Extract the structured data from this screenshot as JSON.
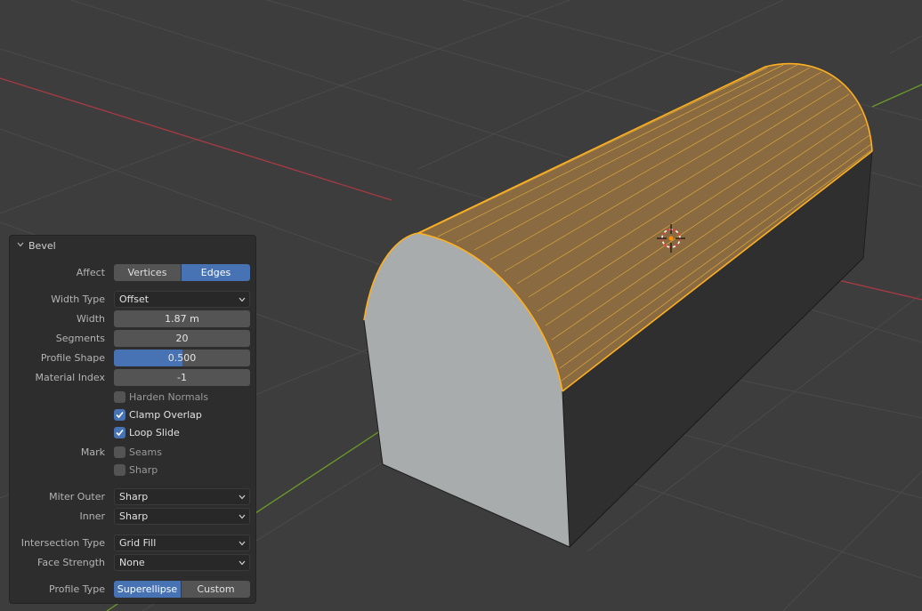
{
  "panel": {
    "title": "Bevel",
    "affect": {
      "label": "Affect",
      "options": [
        "Vertices",
        "Edges"
      ],
      "selected": "Edges"
    },
    "width_type": {
      "label": "Width Type",
      "value": "Offset"
    },
    "width": {
      "label": "Width",
      "value": "1.87 m"
    },
    "segments": {
      "label": "Segments",
      "value": "20"
    },
    "profile_shape": {
      "label": "Profile Shape",
      "value": "0.500",
      "fraction": 0.5
    },
    "material_index": {
      "label": "Material Index",
      "value": "-1"
    },
    "harden_normals": {
      "label": "Harden Normals",
      "checked": false
    },
    "clamp_overlap": {
      "label": "Clamp Overlap",
      "checked": true
    },
    "loop_slide": {
      "label": "Loop Slide",
      "checked": true
    },
    "mark": {
      "label": "Mark",
      "seams": {
        "label": "Seams",
        "checked": false
      },
      "sharp": {
        "label": "Sharp",
        "checked": false
      }
    },
    "miter_outer": {
      "label": "Miter Outer",
      "value": "Sharp"
    },
    "inner": {
      "label": "Inner",
      "value": "Sharp"
    },
    "intersection_type": {
      "label": "Intersection Type",
      "value": "Grid Fill"
    },
    "face_strength": {
      "label": "Face Strength",
      "value": "None"
    },
    "profile_type": {
      "label": "Profile Type",
      "options": [
        "Superellipse",
        "Custom"
      ],
      "selected": "Superellipse"
    }
  },
  "colors": {
    "background": "#3d3d3d",
    "accent": "#4772b3",
    "selection": "#ffb020",
    "x_axis": "#a83a44",
    "y_axis": "#6a9a2a",
    "mesh_front": "#a8acac",
    "mesh_top": "#8a6a40"
  }
}
